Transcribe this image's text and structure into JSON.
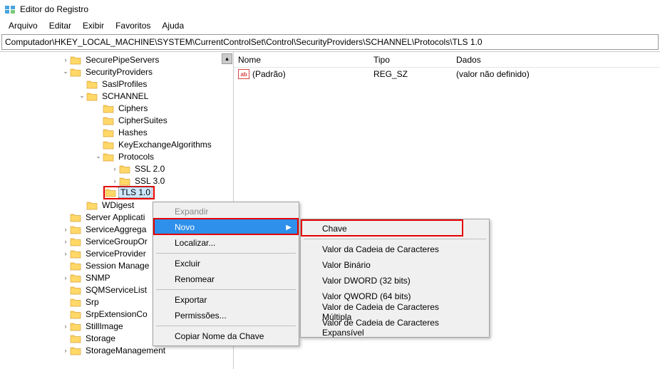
{
  "window": {
    "title": "Editor do Registro"
  },
  "menubar": [
    "Arquivo",
    "Editar",
    "Exibir",
    "Favoritos",
    "Ajuda"
  ],
  "addressbar": "Computador\\HKEY_LOCAL_MACHINE\\SYSTEM\\CurrentControlSet\\Control\\SecurityProviders\\SCHANNEL\\Protocols\\TLS 1.0",
  "tree": [
    {
      "indent": 86,
      "tw": "closed",
      "label": "SecurePipeServers"
    },
    {
      "indent": 86,
      "tw": "open",
      "label": "SecurityProviders"
    },
    {
      "indent": 109,
      "tw": "blank",
      "label": "SaslProfiles"
    },
    {
      "indent": 109,
      "tw": "open",
      "label": "SCHANNEL"
    },
    {
      "indent": 132,
      "tw": "blank",
      "label": "Ciphers"
    },
    {
      "indent": 132,
      "tw": "blank",
      "label": "CipherSuites"
    },
    {
      "indent": 132,
      "tw": "blank",
      "label": "Hashes"
    },
    {
      "indent": 132,
      "tw": "blank",
      "label": "KeyExchangeAlgorithms"
    },
    {
      "indent": 132,
      "tw": "open",
      "label": "Protocols"
    },
    {
      "indent": 155,
      "tw": "closed",
      "label": "SSL 2.0"
    },
    {
      "indent": 155,
      "tw": "closed",
      "label": "SSL 3.0"
    },
    {
      "indent": 155,
      "tw": "blank",
      "label": "TLS 1.0",
      "selected": true,
      "red": true
    },
    {
      "indent": 109,
      "tw": "blank",
      "label": "WDigest"
    },
    {
      "indent": 86,
      "tw": "blank",
      "label": "Server Applicati"
    },
    {
      "indent": 86,
      "tw": "closed",
      "label": "ServiceAggrega"
    },
    {
      "indent": 86,
      "tw": "closed",
      "label": "ServiceGroupOr"
    },
    {
      "indent": 86,
      "tw": "closed",
      "label": "ServiceProvider"
    },
    {
      "indent": 86,
      "tw": "blank",
      "label": "Session Manage"
    },
    {
      "indent": 86,
      "tw": "closed",
      "label": "SNMP"
    },
    {
      "indent": 86,
      "tw": "blank",
      "label": "SQMServiceList"
    },
    {
      "indent": 86,
      "tw": "blank",
      "label": "Srp"
    },
    {
      "indent": 86,
      "tw": "blank",
      "label": "SrpExtensionCo"
    },
    {
      "indent": 86,
      "tw": "closed",
      "label": "StillImage"
    },
    {
      "indent": 86,
      "tw": "blank",
      "label": "Storage"
    },
    {
      "indent": 86,
      "tw": "closed",
      "label": "StorageManagement"
    }
  ],
  "list": {
    "headers": {
      "nome": "Nome",
      "tipo": "Tipo",
      "dados": "Dados"
    },
    "rows": [
      {
        "nome": "(Padrão)",
        "tipo": "REG_SZ",
        "dados": "(valor não definido)"
      }
    ]
  },
  "ctx1": {
    "items": [
      {
        "label": "Expandir",
        "disabled": true
      },
      {
        "label": "Novo",
        "arrow": true,
        "hover": true,
        "red": true
      },
      {
        "label": "Localizar..."
      },
      {
        "sep": true
      },
      {
        "label": "Excluir"
      },
      {
        "label": "Renomear"
      },
      {
        "sep": true
      },
      {
        "label": "Exportar"
      },
      {
        "label": "Permissões..."
      },
      {
        "sep": true
      },
      {
        "label": "Copiar Nome da Chave"
      }
    ]
  },
  "ctx2": {
    "items": [
      {
        "label": "Chave",
        "red": true
      },
      {
        "sep": true
      },
      {
        "label": "Valor da Cadeia de Caracteres"
      },
      {
        "label": "Valor Binário"
      },
      {
        "label": "Valor DWORD (32 bits)"
      },
      {
        "label": "Valor QWORD (64 bits)"
      },
      {
        "label": "Valor de Cadeia de Caracteres Múltipla"
      },
      {
        "label": "Valor de Cadeia de Caracteres Expansível"
      }
    ]
  }
}
